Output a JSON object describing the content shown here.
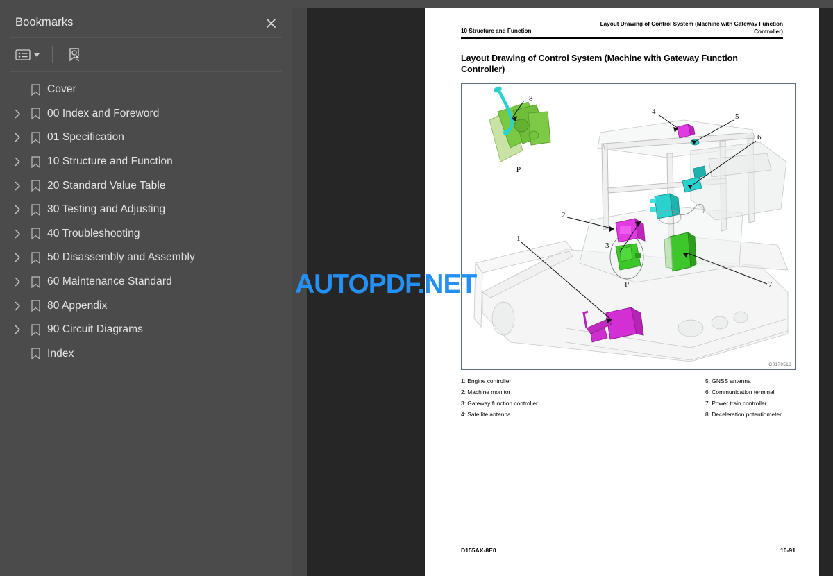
{
  "sidebar": {
    "title": "Bookmarks",
    "close_icon": "close-icon",
    "toolbar": {
      "options_icon": "list-options-icon",
      "dropdown_icon": "chevron-down-icon",
      "find_bookmark_icon": "bookmark-search-icon"
    },
    "items": [
      {
        "label": "Cover",
        "expandable": false
      },
      {
        "label": "00 Index and Foreword",
        "expandable": true
      },
      {
        "label": "01 Specification",
        "expandable": true
      },
      {
        "label": "10 Structure and Function",
        "expandable": true
      },
      {
        "label": "20 Standard Value Table",
        "expandable": true
      },
      {
        "label": "30 Testing and Adjusting",
        "expandable": true
      },
      {
        "label": "40 Troubleshooting",
        "expandable": true
      },
      {
        "label": "50 Disassembly and Assembly",
        "expandable": true
      },
      {
        "label": "60 Maintenance Standard",
        "expandable": true
      },
      {
        "label": "80 Appendix",
        "expandable": true
      },
      {
        "label": "90 Circuit Diagrams",
        "expandable": true
      },
      {
        "label": "Index",
        "expandable": false
      }
    ]
  },
  "document": {
    "running_header_left": "10 Structure and Function",
    "running_header_right": "Layout Drawing of Control System (Machine with Gateway Function Controller)",
    "title": "Layout Drawing of Control System (Machine with Gateway Function Controller)",
    "figure": {
      "id": "G0179518",
      "callouts": [
        "1",
        "2",
        "3",
        "4",
        "5",
        "6",
        "7",
        "8"
      ],
      "detail_marks": [
        "P",
        "P"
      ]
    },
    "legend": [
      "1: Engine controller",
      "2: Machine monitor",
      "3: Gateway function controller",
      "4: Satellite antenna",
      "5: GNSS antenna",
      "6: Communication terminal",
      "7: Power train controller",
      "8: Deceleration potentiometer"
    ],
    "footer_left": "D155AX-8E0",
    "footer_right": "10-91"
  },
  "watermark": {
    "text": "AUTOPDF.NET",
    "color": "#2490f5"
  },
  "colors": {
    "sidebar_bg": "#4b4b4b",
    "viewer_bg": "#262626",
    "page_bg": "#ffffff",
    "text": "#e4e4e4",
    "accent_magenta": "#d42fd4",
    "accent_green": "#3ec72b",
    "accent_cyan": "#2ad2cf",
    "accent_lime": "#7ac943"
  }
}
